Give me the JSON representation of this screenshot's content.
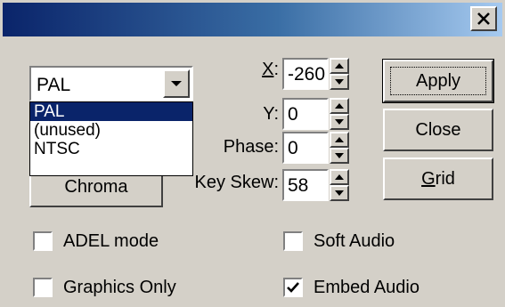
{
  "window": {
    "close_glyph": "✕"
  },
  "format_combo": {
    "selected": "PAL",
    "options": [
      "PAL",
      "(unused)",
      "NTSC"
    ]
  },
  "chroma_button": {
    "label": "Chroma"
  },
  "fields": {
    "x": {
      "label_key": "X",
      "label_rest": ":",
      "value": "-260"
    },
    "y": {
      "label": "Y:",
      "value": "0"
    },
    "phase": {
      "label": "Phase:",
      "value": "0"
    },
    "key_skew": {
      "label": "Key Skew:",
      "value": "58"
    }
  },
  "buttons": {
    "apply": "Apply",
    "close": "Close",
    "grid_key": "G",
    "grid_rest": "rid"
  },
  "checkboxes": {
    "adel_mode": {
      "label": "ADEL mode",
      "checked": false
    },
    "graphics_only": {
      "label": "Graphics Only",
      "checked": false
    },
    "soft_audio": {
      "label": "Soft Audio",
      "checked": false
    },
    "embed_audio": {
      "label": "Embed Audio",
      "checked": true
    }
  },
  "colors": {
    "title_start": "#0a246a",
    "title_end": "#a6caf0",
    "face": "#d4d0c8",
    "highlight": "#0a246a"
  }
}
